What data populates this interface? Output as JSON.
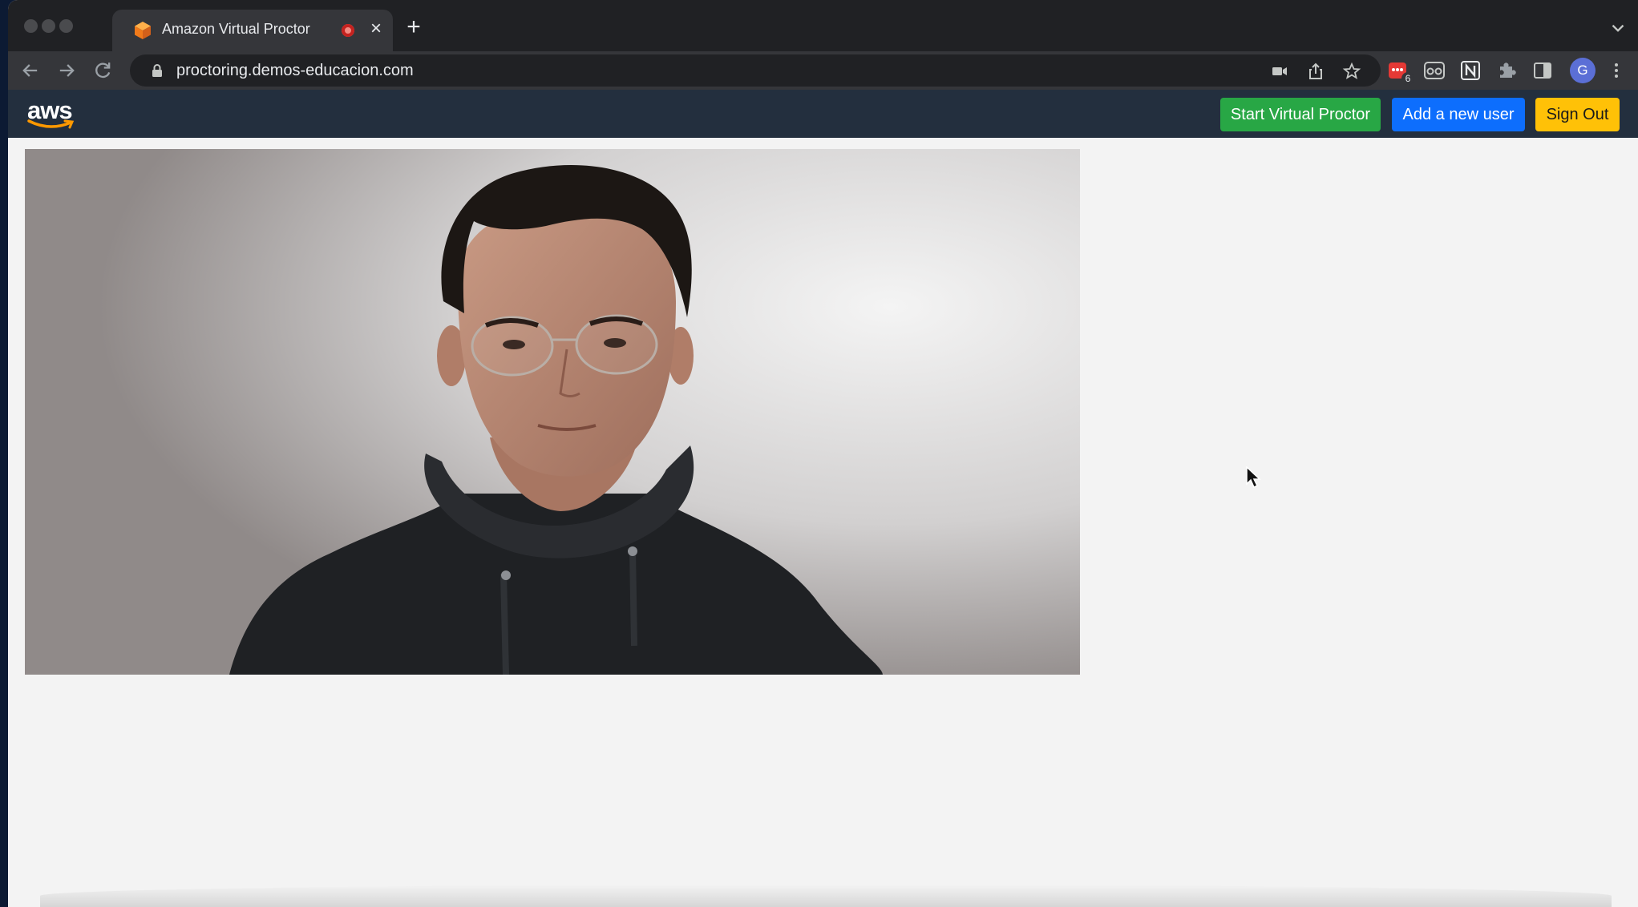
{
  "browser": {
    "tab": {
      "title": "Amazon Virtual Proctor"
    },
    "address_bar": {
      "url": "proctoring.demos-educacion.com"
    },
    "extension_badge_count": "6",
    "profile_initial": "G"
  },
  "app": {
    "navbar": {
      "logo_text": "aws",
      "buttons": {
        "start_virtual_proctor": "Start Virtual Proctor",
        "add_new_user": "Add a new user",
        "sign_out": "Sign Out"
      }
    },
    "main": {
      "video_feed": {
        "description_icon": "webcam-feed"
      }
    }
  },
  "colors": {
    "navbar_bg": "#232f3e",
    "start_button": "#28a745",
    "add_user_button": "#0d6efd",
    "sign_out_button": "#ffc107",
    "aws_smile": "#ff9900"
  }
}
